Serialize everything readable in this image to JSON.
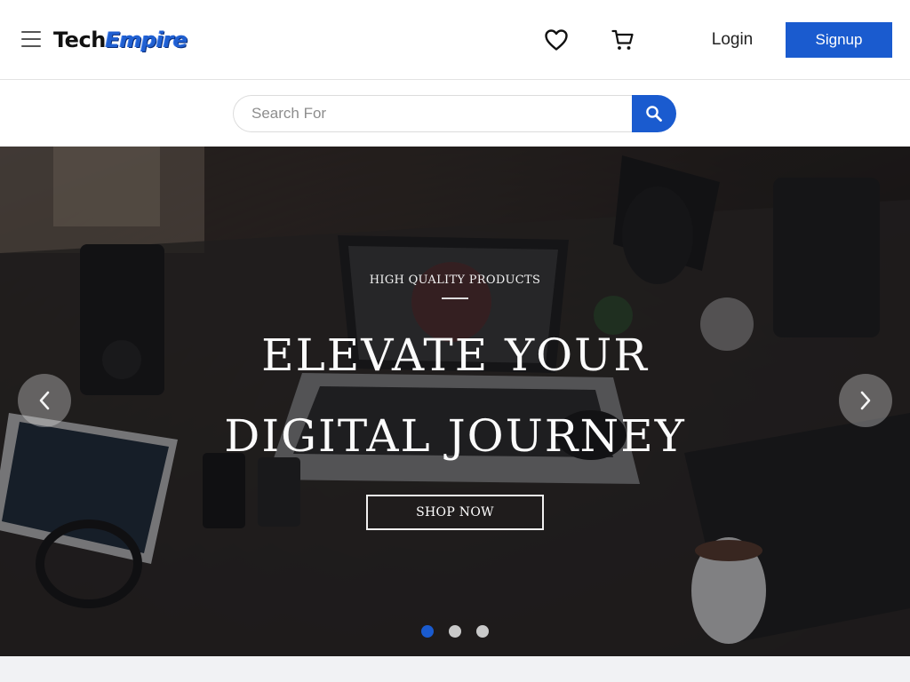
{
  "header": {
    "logo_part1": "Tech",
    "logo_part2": "Empire",
    "login_label": "Login",
    "signup_label": "Signup"
  },
  "search": {
    "placeholder": "Search For",
    "value": ""
  },
  "hero": {
    "kicker": "HIGH QUALITY PRODUCTS",
    "title_line1": "ELEVATE YOUR",
    "title_line2": "DIGITAL JOURNEY",
    "cta_label": "SHOP NOW",
    "slides_count": 3,
    "active_slide": 1
  },
  "icons": {
    "menu": "hamburger-icon",
    "wishlist": "heart-icon",
    "cart": "cart-icon",
    "search": "search-icon",
    "prev": "chevron-left-icon",
    "next": "chevron-right-icon"
  },
  "colors": {
    "brand_blue": "#1a5bcf",
    "dot_inactive": "#c9c9c9",
    "strip_bg": "#f1f2f4"
  }
}
